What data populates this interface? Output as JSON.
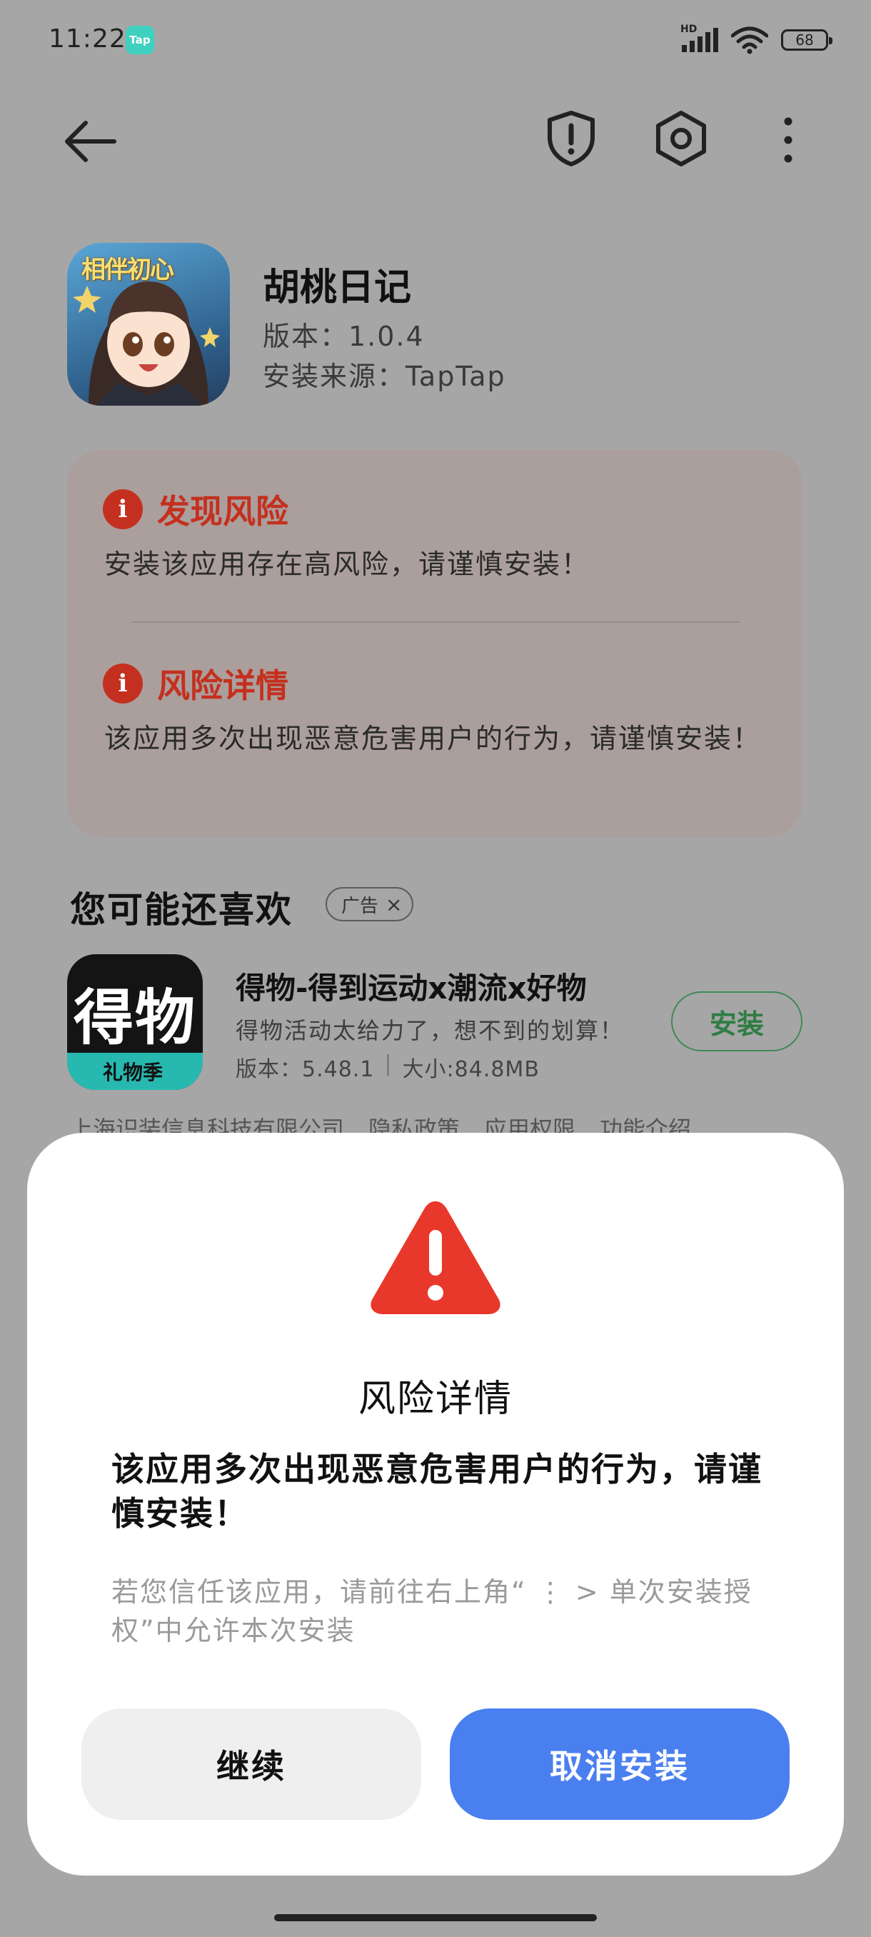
{
  "status_bar": {
    "time": "11:22",
    "app_badge": "Tap",
    "network": "HD",
    "battery": "68"
  },
  "app": {
    "name": "胡桃日记",
    "icon_text": "相伴初心",
    "version": "版本：1.0.4",
    "source": "安装来源：TapTap"
  },
  "risk": {
    "found_title": "发现风险",
    "found_desc": "安装该应用存在高风险，请谨慎安装！",
    "detail_title": "风险详情",
    "detail_desc": "该应用多次出现恶意危害用户的行为，请谨慎安装！",
    "info_glyph": "i"
  },
  "recommend": {
    "title": "您可能还喜欢",
    "ad_label": "广告",
    "ad_close": "×",
    "app": {
      "icon_text": "得物",
      "icon_sub": "礼物季",
      "name": "得物-得到运动x潮流x好物",
      "desc": "得物活动太给力了，想不到的划算！",
      "version": "版本：5.48.1",
      "separator": "|",
      "size": "大小:84.8MB",
      "install_label": "安装"
    },
    "footer_links": [
      "上海识装信息科技有限公司",
      "隐私政策",
      "应用权限",
      "功能介绍"
    ]
  },
  "dialog": {
    "title": "风险详情",
    "message": "该应用多次出现恶意危害用户的行为，请谨慎安装！",
    "hint": "若您信任该应用，请前往右上角“ ⋮ > 单次安装授权”中允许本次安装",
    "continue_label": "继续",
    "cancel_label": "取消安装"
  },
  "colors": {
    "accent_blue": "#4a7ff0",
    "risk_red": "#c4301f",
    "warning_red": "#e8382b",
    "install_green": "#2f7d45"
  },
  "icons": [
    "back-arrow-icon",
    "shield-alert-icon",
    "gear-icon",
    "more-vertical-icon",
    "info-icon",
    "warning-triangle-icon"
  ]
}
